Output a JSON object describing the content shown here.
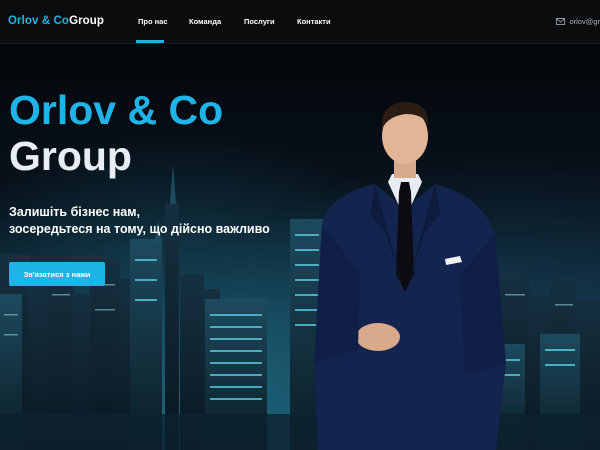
{
  "header": {
    "logo_accent": "Orlov & Co",
    "logo_rest": "Group",
    "nav": [
      {
        "label": "Про нас",
        "active": true
      },
      {
        "label": "Команда",
        "active": false
      },
      {
        "label": "Послуги",
        "active": false
      },
      {
        "label": "Контакти",
        "active": false
      }
    ],
    "email": "orlov@gr"
  },
  "hero": {
    "title_line1": "Orlov & Co",
    "title_line2": "Group",
    "tagline_line1": "Залишіть бізнес нам,",
    "tagline_line2": "зосередьтеся на тому, що дійсно важливо",
    "cta_label": "Зв'язатися з нами"
  },
  "colors": {
    "accent": "#1fb4e8",
    "nav_background": "#0b0c0e",
    "hero_background": "#0d2433"
  },
  "icons": {
    "email": "mail-icon"
  }
}
